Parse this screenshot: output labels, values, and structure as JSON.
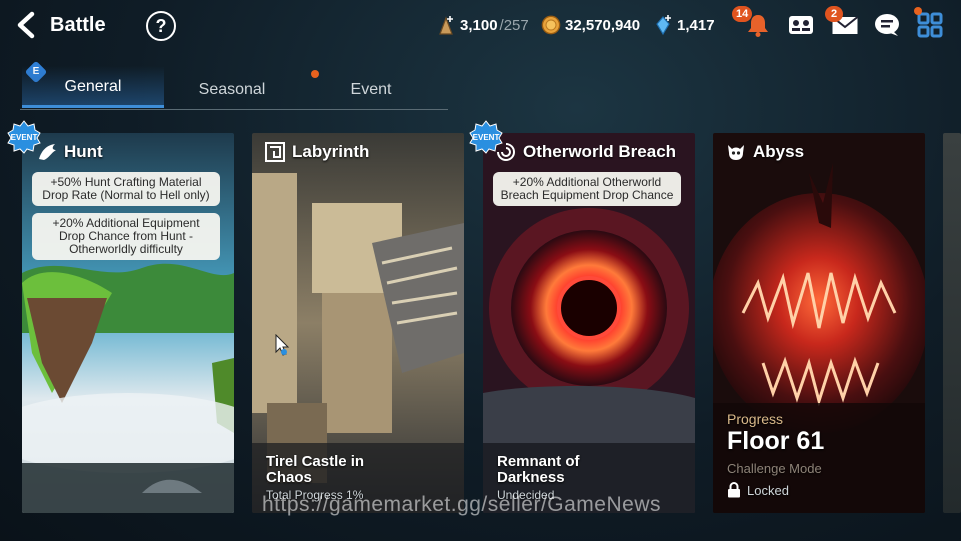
{
  "header": {
    "back_label": "Battle",
    "help_glyph": "?",
    "stamina": {
      "current": "3,100",
      "max": "/257",
      "icon": "stamina-icon"
    },
    "gold": {
      "value": "32,570,940",
      "icon": "gold-coin-icon"
    },
    "crystals": {
      "value": "1,417",
      "icon": "crystal-icon"
    },
    "notifications_count": "14",
    "mail_count": "2"
  },
  "tabs": [
    {
      "label": "General",
      "active": true
    },
    {
      "label": "Seasonal",
      "active": false
    },
    {
      "label": "Event",
      "active": false
    }
  ],
  "e_badge": "E",
  "event_tag": "EVENT",
  "cards": [
    {
      "title": "Hunt",
      "bonuses": [
        "+50% Hunt Crafting Material Drop Rate (Normal to Hell only)",
        "+20% Additional Equipment Drop Chance from Hunt - Otherworldly difficulty"
      ]
    },
    {
      "title": "Labyrinth",
      "subtitle": "Tirel Castle in Chaos",
      "status": "Total Progress 1%"
    },
    {
      "title": "Otherworld Breach",
      "bonuses": [
        "+20% Additional Otherworld Breach Equipment Drop Chance"
      ],
      "subtitle": "Remnant of Darkness",
      "status": "Undecided"
    },
    {
      "title": "Abyss",
      "progress_label": "Progress",
      "floor": "Floor 61",
      "mode": "Challenge Mode",
      "lock_label": "Locked"
    }
  ],
  "watermark": "https://gamemarket.gg/seller/GameNews",
  "colors": {
    "accent": "#3e8ed8",
    "badge": "#e0541f",
    "event_badge": "#2a8fe0"
  }
}
